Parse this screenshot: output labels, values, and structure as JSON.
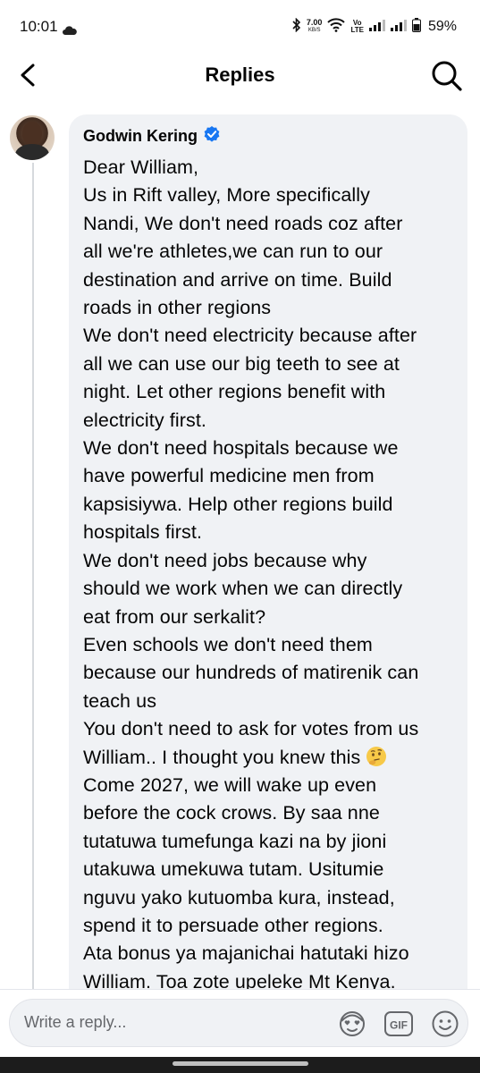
{
  "status_bar": {
    "time": "10:01",
    "speed_value": "7.00",
    "speed_unit": "KB/S",
    "volte_top": "Vo",
    "volte_bottom": "LTE",
    "battery": "59%"
  },
  "header": {
    "title": "Replies"
  },
  "comment": {
    "author": "Godwin Kering",
    "verified": true,
    "lines": [
      "Dear William,",
      "Us in Rift valley, More specifically",
      "Nandi, We don't need roads coz after",
      "all we're athletes,we can run to our",
      "destination and arrive on time. Build",
      "roads in other regions",
      "We don't need electricity because after",
      "all we can use our big teeth to see at",
      "night. Let other regions benefit with",
      "electricity first.",
      "We don't need hospitals because we",
      "have powerful medicine men from",
      "kapsisiywa. Help other regions build",
      "hospitals first.",
      "We don't need jobs because why",
      "should we work when we can directly",
      "eat from our serkalit?",
      "Even schools we don't need them",
      "because our hundreds of matirenik can",
      "teach us",
      "You don't need to ask for votes from us",
      "William.. I thought you knew this",
      "Come 2027, we will wake up even",
      "before the cock crows. By saa nne",
      "tutatuwa tumefunga kazi na by jioni",
      "utakuwa umekuwa tutam. Usitumie",
      "nguvu yako kutuomba kura, instead,",
      "spend it to persuade other regions.",
      "Ata bonus ya majanichai hatutaki hizo",
      "William. Toa zote upeleke Mt Kenya."
    ],
    "emoji": "thinking-face"
  },
  "reply_bar": {
    "placeholder": "Write a reply...",
    "gif_label": "GIF"
  },
  "colors": {
    "bubble_bg": "#f0f2f5",
    "verified_blue": "#1877f2",
    "text": "#050505",
    "placeholder": "#65676b"
  }
}
